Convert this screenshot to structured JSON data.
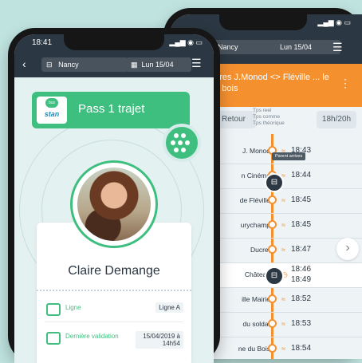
{
  "back_phone": {
    "toolbar": {
      "city": "Nancy",
      "date": "Lun 15/04"
    },
    "route": {
      "name": "... res J.Monod <> Fléville ... le du bois"
    },
    "direction_tabs": {
      "return": "Retour",
      "time_range": "18h/20h"
    },
    "legend": [
      "Tps reel",
      "Tps comme",
      "Tps théorique"
    ],
    "tooltip": "Parent arrives",
    "stops": [
      {
        "name": "J. Monod",
        "time": "18:43"
      },
      {
        "name": "n Cinéma",
        "time": "18:44"
      },
      {
        "name": "de Fléville",
        "time": "18:45"
      },
      {
        "name": "urychamp",
        "time": "18:45"
      },
      {
        "name": "Ducret",
        "time": "18:47"
      },
      {
        "name": "Château",
        "time": "18:46",
        "time2": "18:49"
      },
      {
        "name": "ille Mairie",
        "time": "18:52"
      },
      {
        "name": "du soldat",
        "time": "18:53"
      },
      {
        "name": "ne du Bois",
        "time": "18:54"
      }
    ]
  },
  "front_phone": {
    "status_time": "18:41",
    "toolbar": {
      "city": "Nancy",
      "date": "Lun 15/04"
    },
    "logo": {
      "badge": "bus",
      "text": "stan"
    },
    "pass_title": "Pass 1 trajet",
    "passenger_name": "Claire Demange",
    "fields": [
      {
        "label": "Ligne",
        "value": "Ligne A"
      },
      {
        "label": "Dernière validation",
        "value": "15/04/2019 à 14h54"
      }
    ]
  }
}
